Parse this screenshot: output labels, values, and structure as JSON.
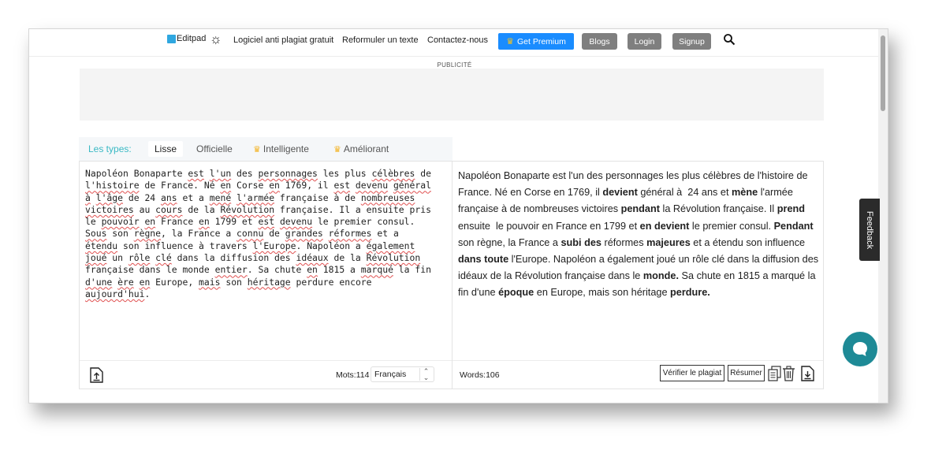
{
  "nav": {
    "logo": "Editpad",
    "links": [
      "Logiciel anti plagiat gratuit",
      "Reformuler un texte",
      "Contactez-nous"
    ],
    "premium": "Get Premium",
    "blogs": "Blogs",
    "login": "Login",
    "signup": "Signup"
  },
  "ad": {
    "label": "PUBLICITÉ"
  },
  "tabs": {
    "title": "Les types:",
    "items": [
      "Lisse",
      "Officielle",
      "Intelligente",
      "Améliorant"
    ],
    "active": "Lisse"
  },
  "input": {
    "word_count": "Mots:114",
    "language": "Français"
  },
  "output": {
    "word_count": "Words:106",
    "check_button": "Vérifier le plagiat",
    "summarize_button": "Résumer"
  },
  "feedback": "Feedback",
  "colors": {
    "accent_blue": "#1a8cff",
    "grey_button": "#7f7f7f",
    "teal": "#1e8a96",
    "tab_title": "#39b9c4",
    "crown": "#f7c21c"
  }
}
